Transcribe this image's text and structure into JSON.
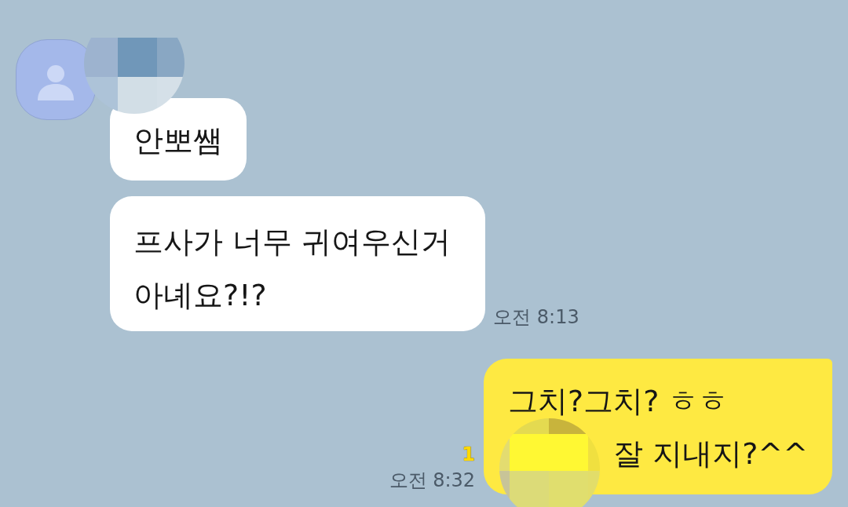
{
  "chat": {
    "messages": [
      {
        "kind": "incoming",
        "sender": {
          "name_redacted": true
        },
        "bubbles": [
          {
            "lines": [
              {
                "text": "안뽀쌤",
                "redacted_before": false
              }
            ]
          },
          {
            "lines": [
              {
                "text": "프사가 너무 귀여우신거",
                "redacted_before": false
              },
              {
                "text": "아녜요?!?",
                "redacted_before": false
              }
            ]
          }
        ],
        "time": "오전 8:13"
      },
      {
        "kind": "outgoing",
        "unread": "1",
        "bubbles": [
          {
            "lines": [
              {
                "text": "그치?그치? ㅎㅎ",
                "redacted_before": false
              },
              {
                "text": "잘 지내지?^^",
                "redacted_before": true
              }
            ]
          }
        ],
        "time": "오전 8:32"
      }
    ]
  }
}
